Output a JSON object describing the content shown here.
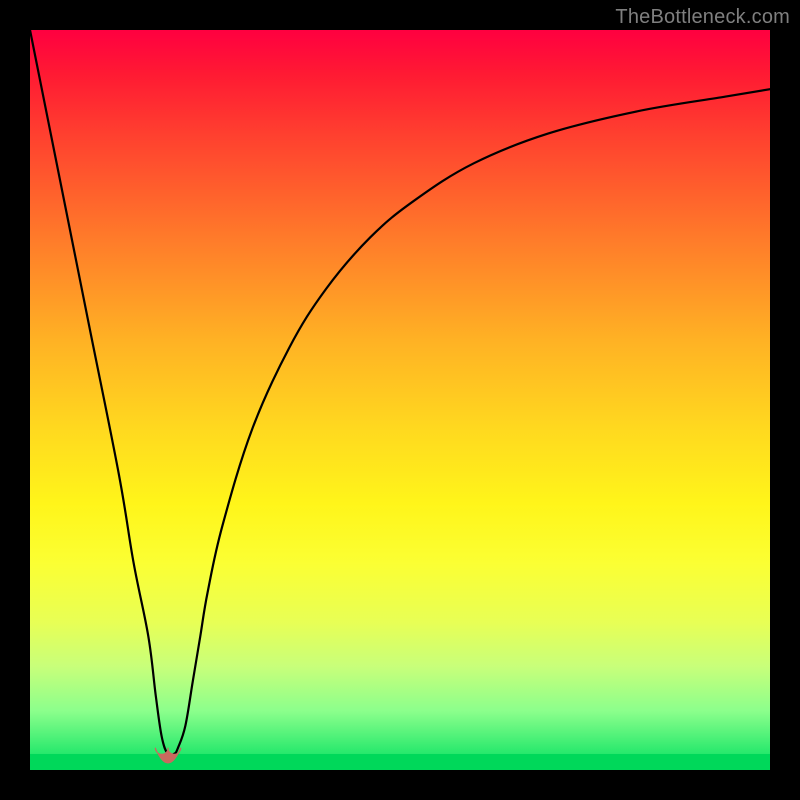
{
  "watermark": "TheBottleneck.com",
  "colors": {
    "frame": "#000000",
    "gradient_top": "#ff0040",
    "gradient_bottom": "#00e060",
    "curve": "#000000",
    "marker": "#c86a5e",
    "watermark_text": "#7f7f7f"
  },
  "chart_data": {
    "type": "line",
    "title": "",
    "xlabel": "",
    "ylabel": "",
    "xlim": [
      0,
      100
    ],
    "ylim": [
      0,
      100
    ],
    "grid": false,
    "legend": false,
    "background": "vertical gradient red→orange→yellow→green; green = low bottleneck, red = high",
    "series": [
      {
        "name": "bottleneck-curve",
        "x": [
          0,
          4,
          8,
          12,
          14,
          16,
          17,
          17.8,
          18.6,
          19.5,
          20,
          21,
          22,
          23,
          24,
          26,
          30,
          35,
          40,
          46,
          52,
          60,
          70,
          82,
          94,
          100
        ],
        "values": [
          100,
          80,
          60,
          40,
          28,
          18,
          10,
          4.5,
          2.2,
          2.2,
          3,
          6,
          12,
          18,
          24,
          33,
          46,
          57,
          65,
          72,
          77,
          82,
          86,
          89,
          91,
          92
        ]
      }
    ],
    "markers": [
      {
        "name": "valley-left-point",
        "x": 17.8,
        "y": 3.0
      },
      {
        "name": "valley-right-point",
        "x": 19.5,
        "y": 3.0
      }
    ],
    "notes": "Single V-shaped curve on a red-to-green vertical gradient. No axis ticks, labels, or title are shown. Values above are read from the image at the precision the plot implies (integer percent)."
  }
}
